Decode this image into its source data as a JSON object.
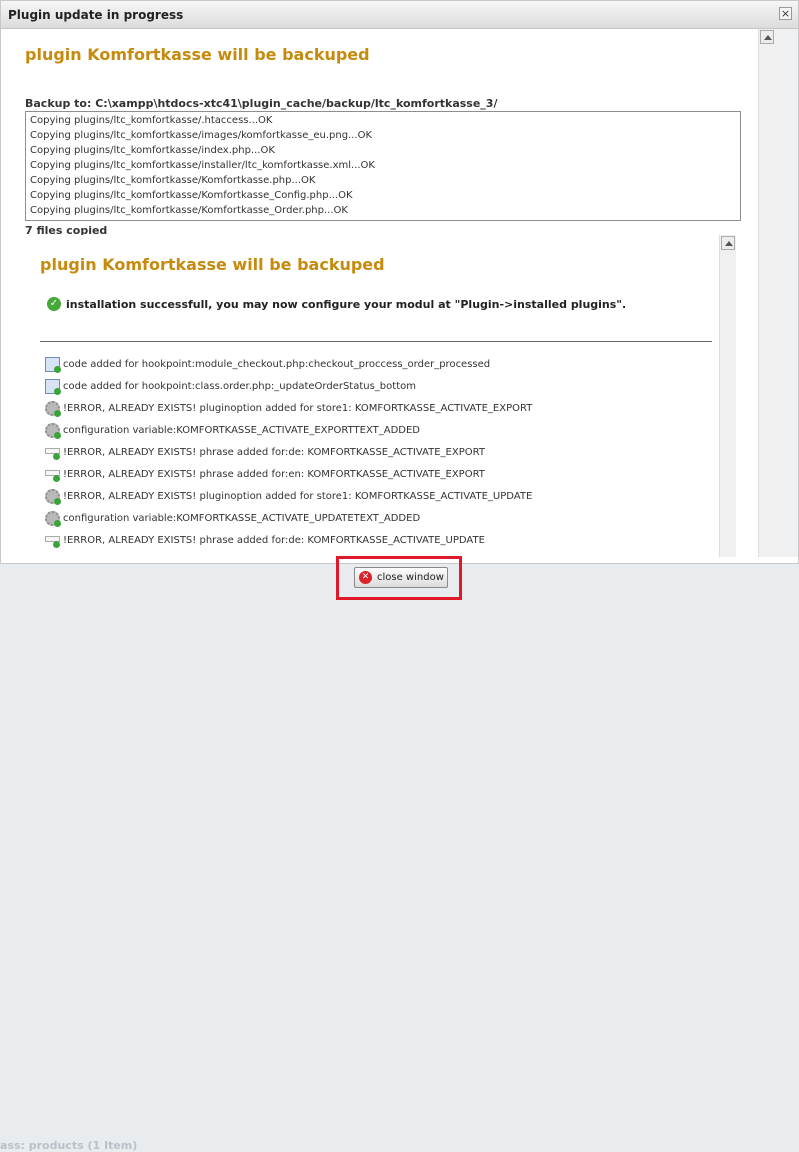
{
  "dialog": {
    "title": "Plugin update in progress",
    "close_icon": "×"
  },
  "outer": {
    "heading": "plugin Komfortkasse will be backuped",
    "backup_to": "Backup to: C:\\xampp\\htdocs-xtc41\\plugin_cache/backup/ltc_komfortkasse_3/",
    "log_lines": [
      "Copying plugins/ltc_komfortkasse/.htaccess...OK",
      "Copying plugins/ltc_komfortkasse/images/komfortkasse_eu.png...OK",
      "Copying plugins/ltc_komfortkasse/index.php...OK",
      "Copying plugins/ltc_komfortkasse/installer/ltc_komfortkasse.xml...OK",
      "Copying plugins/ltc_komfortkasse/Komfortkasse.php...OK",
      "Copying plugins/ltc_komfortkasse/Komfortkasse_Config.php...OK",
      "Copying plugins/ltc_komfortkasse/Komfortkasse_Order.php...OK"
    ],
    "files_copied": "7 files copied"
  },
  "inner": {
    "heading": "plugin Komfortkasse will be backuped",
    "success_message": "installation successfull, you may now configure your modul at \"Plugin->installed plugins\".",
    "success_icon": "check-circle-icon",
    "rows": [
      {
        "icon": "document-add-icon",
        "text": "code added for hookpoint:module_checkout.php:checkout_proccess_order_processed"
      },
      {
        "icon": "document-add-icon",
        "text": "code added for hookpoint:class.order.php:_updateOrderStatus_bottom"
      },
      {
        "icon": "gear-add-icon",
        "text": "!ERROR, ALREADY EXISTS! pluginoption added for store1: KOMFORTKASSE_ACTIVATE_EXPORT"
      },
      {
        "icon": "gear-add-icon",
        "text": "configuration variable:KOMFORTKASSE_ACTIVATE_EXPORTTEXT_ADDED"
      },
      {
        "icon": "phrase-add-icon",
        "text": "!ERROR, ALREADY EXISTS! phrase added for:de: KOMFORTKASSE_ACTIVATE_EXPORT"
      },
      {
        "icon": "phrase-add-icon",
        "text": "!ERROR, ALREADY EXISTS! phrase added for:en: KOMFORTKASSE_ACTIVATE_EXPORT"
      },
      {
        "icon": "gear-add-icon",
        "text": "!ERROR, ALREADY EXISTS! pluginoption added for store1: KOMFORTKASSE_ACTIVATE_UPDATE"
      },
      {
        "icon": "gear-add-icon",
        "text": "configuration variable:KOMFORTKASSE_ACTIVATE_UPDATETEXT_ADDED"
      },
      {
        "icon": "phrase-add-icon",
        "text": "!ERROR, ALREADY EXISTS! phrase added for:de: KOMFORTKASSE_ACTIVATE_UPDATE"
      }
    ]
  },
  "footer": {
    "close_button_label": "close window",
    "close_button_icon": "close-circle-icon"
  },
  "background": {
    "status_text": "ass: products (1 Item)"
  },
  "colors": {
    "heading": "#c68a0c",
    "highlight": "#e0192a"
  }
}
